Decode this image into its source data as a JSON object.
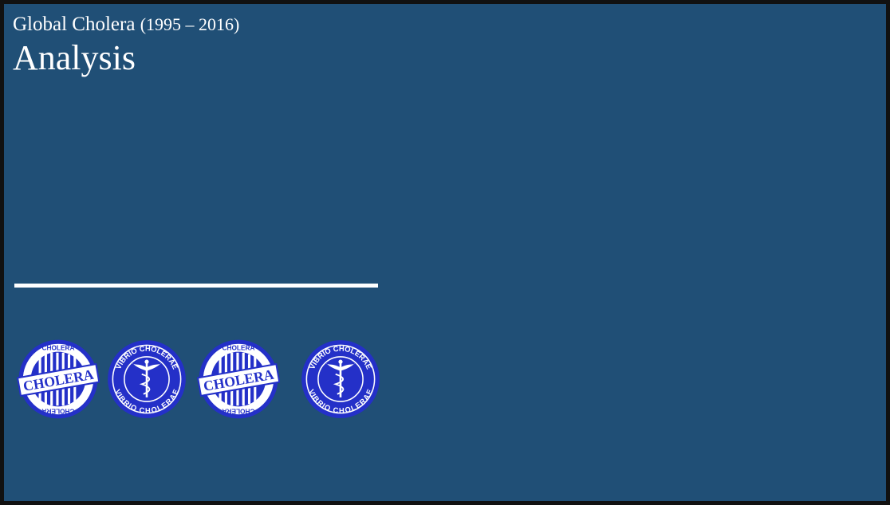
{
  "slide": {
    "title": "Global Cholera",
    "title_years": "(1995 – 2016)",
    "subtitle": "Analysis"
  },
  "stamps": [
    {
      "kind": "cholera-stamp",
      "text": "CHOLERA"
    },
    {
      "kind": "vibrio-cholerae-stamp",
      "text": "VIBRIO CHOLERAE"
    },
    {
      "kind": "cholera-stamp",
      "text": "CHOLERA"
    },
    {
      "kind": "vibrio-cholerae-stamp",
      "text": "VIBRIO CHOLERAE"
    }
  ],
  "colors": {
    "frame": "#111111",
    "background": "#204f76",
    "text": "#ffffff",
    "stamp_blue": "#2430c8"
  }
}
